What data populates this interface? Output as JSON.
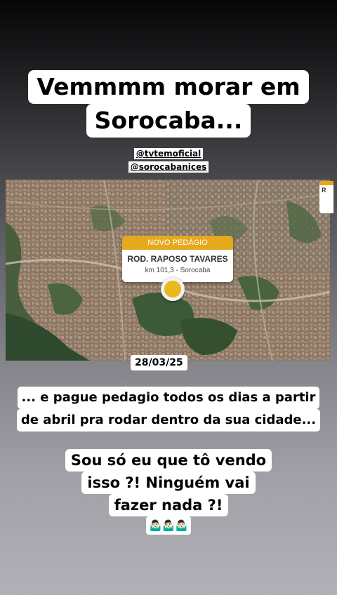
{
  "story": {
    "headline": [
      "Vemmmm morar em",
      "Sorocaba..."
    ],
    "handles": [
      "@tvtemoficial",
      "@sorocabanices"
    ],
    "map": {
      "toll_header": "NOVO PEDÁGIO",
      "toll_road": "ROD. RAPOSO TAVARES",
      "toll_location": "km 101,3 - Sorocaba",
      "edge_card_text": "R",
      "colors": {
        "toll_header": "#e5a91e",
        "marker": "#e9b81f"
      }
    },
    "date": "28/03/25",
    "caption": [
      "... e pague pedagio todos os dias a partir",
      "de abril pra rodar dentro da sua cidade..."
    ],
    "question": [
      "Sou só eu que tô vendo",
      "isso ?! Ninguém vai",
      "fazer nada ?!"
    ],
    "emoji": "🤷🏻‍♂️🤷🏻‍♂️🤷🏻‍♂️"
  }
}
